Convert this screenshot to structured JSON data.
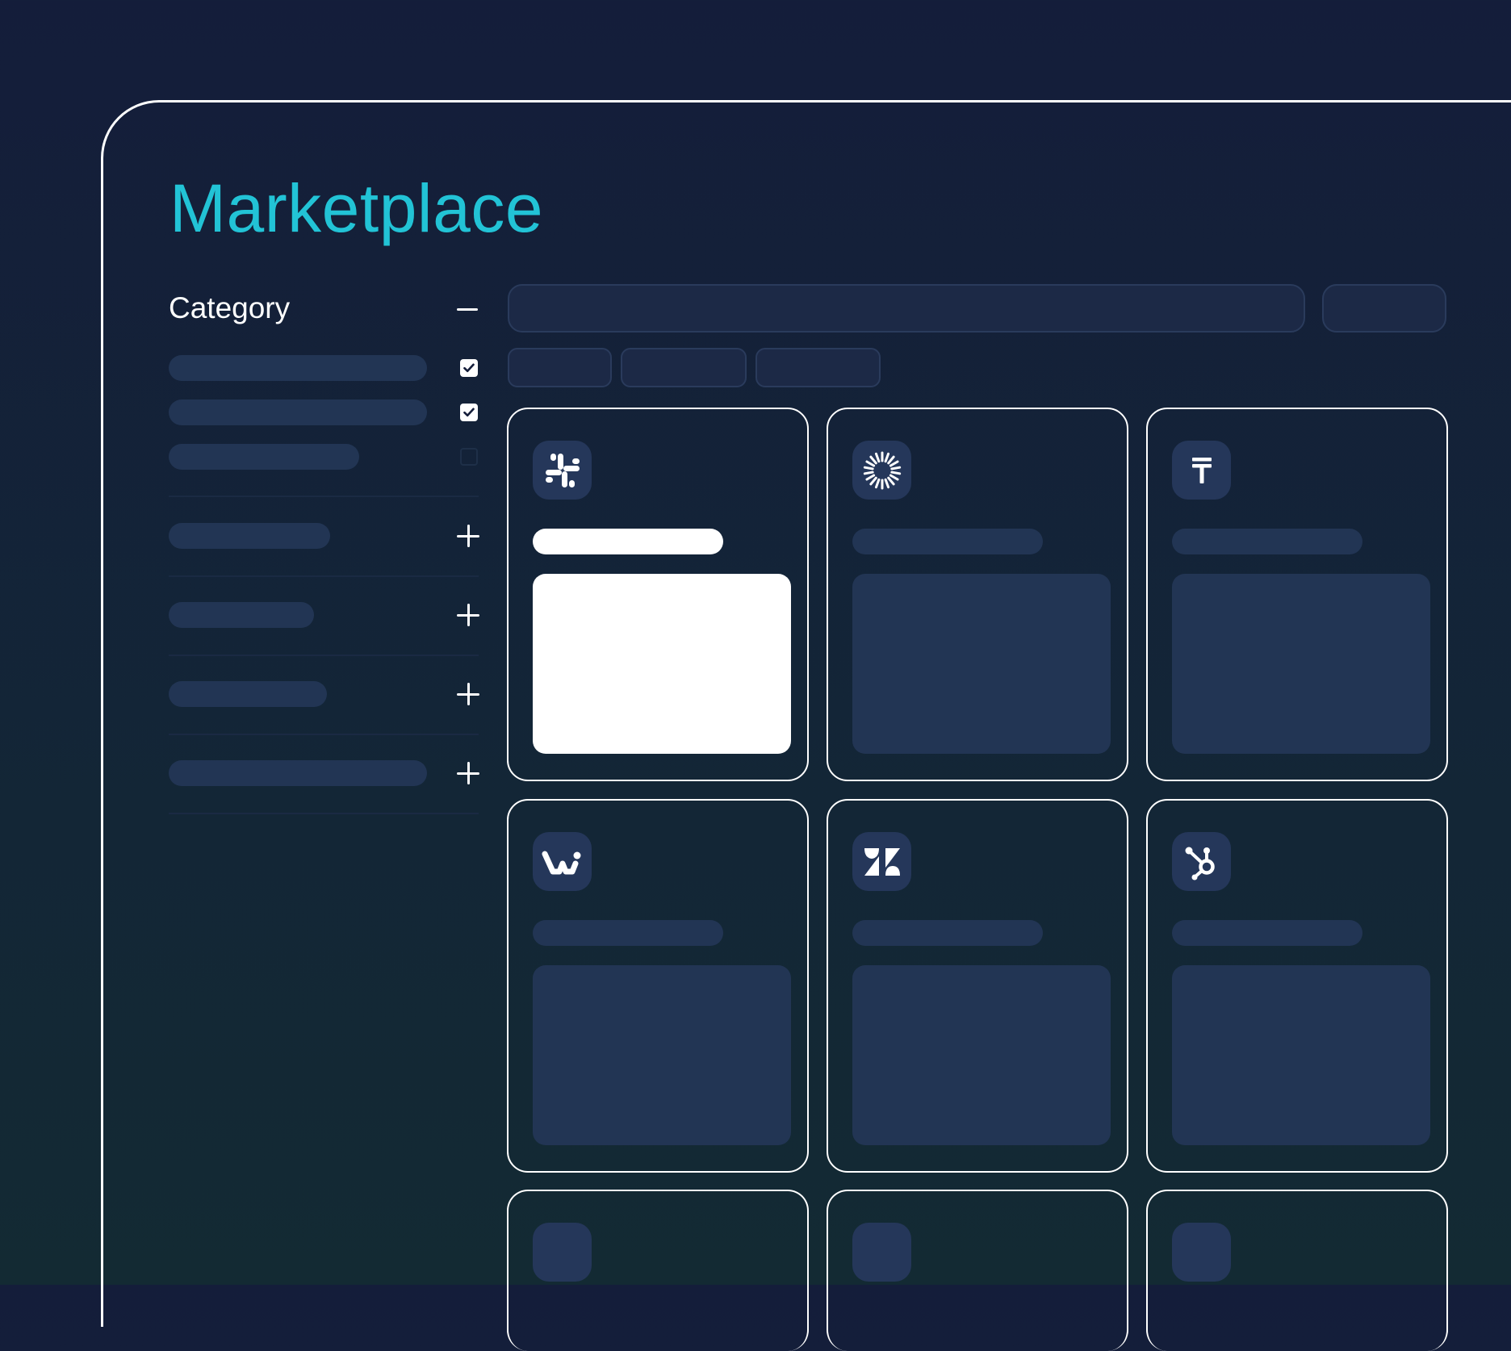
{
  "page": {
    "title": "Marketplace"
  },
  "sidebar": {
    "category_label": "Category",
    "collapse_icon": "minus-icon",
    "category_options": [
      {
        "checked": true
      },
      {
        "checked": true
      },
      {
        "checked": false
      }
    ],
    "filter_groups": [
      {
        "expand_icon": "plus-icon"
      },
      {
        "expand_icon": "plus-icon"
      },
      {
        "expand_icon": "plus-icon"
      },
      {
        "expand_icon": "plus-icon"
      }
    ]
  },
  "toolbar": {
    "search_icon": "none",
    "chips_count_visible": 3
  },
  "apps": [
    {
      "logo": "slack-icon",
      "selected": true
    },
    {
      "logo": "sunburst-icon",
      "selected": false
    },
    {
      "logo": "tally-t-icon",
      "selected": false
    },
    {
      "logo": "wrike-w-icon",
      "selected": false
    },
    {
      "logo": "zendesk-icon",
      "selected": false
    },
    {
      "logo": "hubspot-icon",
      "selected": false
    }
  ],
  "colors": {
    "accent": "#22c3d6",
    "background_top": "#141d3a",
    "background_bottom": "#132a33",
    "placeholder": "#223554",
    "logo_tile": "#25375a",
    "card_border": "#ffffff"
  }
}
